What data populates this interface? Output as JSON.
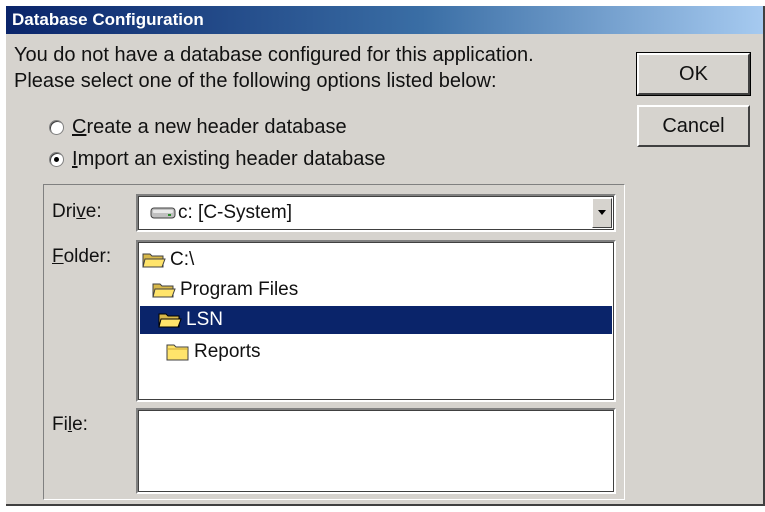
{
  "window": {
    "title": "Database Configuration"
  },
  "message": {
    "line1": "You do not have a database configured for this application.",
    "line2": "Please select one of the following options listed below:"
  },
  "buttons": {
    "ok": "OK",
    "cancel": "Cancel"
  },
  "options": {
    "create_pre": "",
    "create_key": "C",
    "create_rest": "reate a new header database",
    "import_pre": "",
    "import_key": "I",
    "import_rest": "mport an existing header database",
    "selected": "import"
  },
  "drive": {
    "label_pre": "Dri",
    "label_key": "v",
    "label_post": "e:",
    "value": "c: [C-System]"
  },
  "folder": {
    "label_key": "F",
    "label_rest": "older:",
    "items": [
      {
        "name": "C:\\",
        "state": "open"
      },
      {
        "name": "Program Files",
        "state": "open"
      },
      {
        "name": "LSN",
        "state": "open-selected"
      },
      {
        "name": "Reports",
        "state": "closed"
      }
    ]
  },
  "file": {
    "label_pre": "Fi",
    "label_key": "l",
    "label_post": "e:",
    "value": ""
  },
  "colors": {
    "face": "#d6d3ce",
    "title_start": "#0a246a",
    "title_end": "#a6caf0",
    "selection": "#0a246a",
    "folder_yellow": "#ffe46b"
  }
}
